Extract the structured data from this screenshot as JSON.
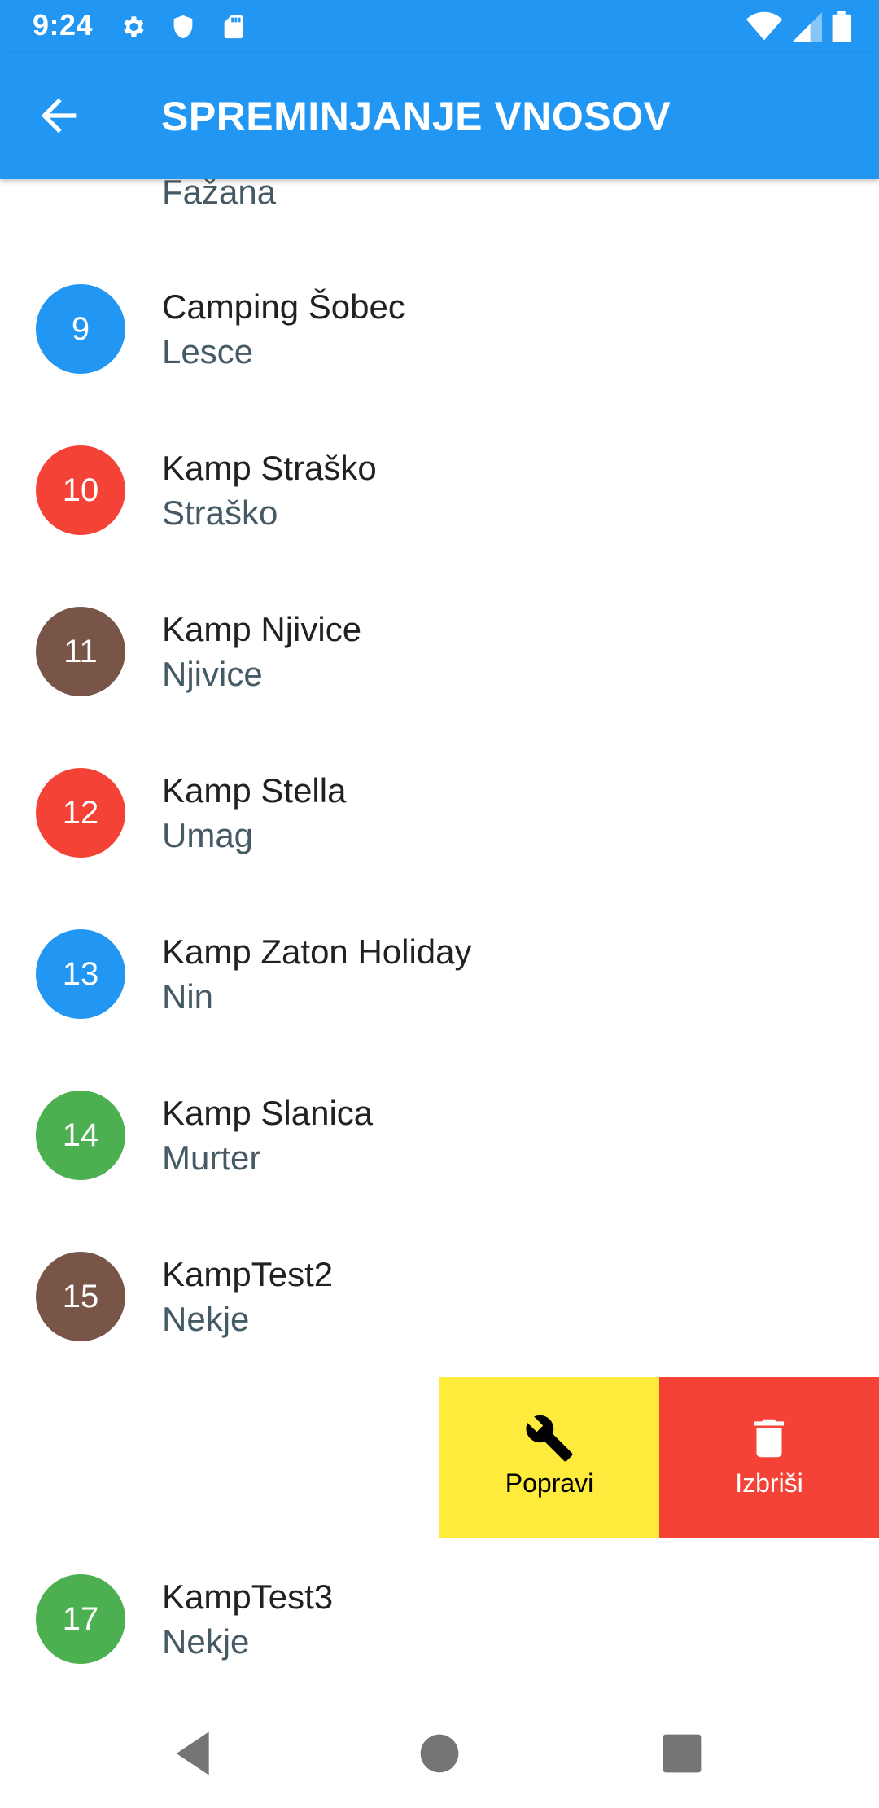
{
  "status_bar": {
    "time": "9:24",
    "left_icons": [
      "gear-icon",
      "shield-icon",
      "sd-card-icon"
    ],
    "right_icons": [
      "wifi-icon",
      "signal-icon",
      "battery-icon"
    ]
  },
  "app_bar": {
    "title": "SPREMINJANJE VNOSOV",
    "back_icon": "arrow-back-icon"
  },
  "colors": {
    "primary": "#2196F3",
    "green": "#4CAF50",
    "blue": "#2196F3",
    "red": "#F44336",
    "brown": "#795548",
    "edit_action": "#FFEB3B",
    "delete_action": "#F44336"
  },
  "list": {
    "partial_item": {
      "place": "Fažana"
    },
    "items": [
      {
        "number": "9",
        "name": "Camping Šobec",
        "place": "Lesce"
      },
      {
        "number": "10",
        "name": "Kamp Straško",
        "place": "Straško"
      },
      {
        "number": "11",
        "name": "Kamp Njivice",
        "place": "Njivice"
      },
      {
        "number": "12",
        "name": "Kamp Stella",
        "place": "Umag"
      },
      {
        "number": "13",
        "name": "Kamp Zaton Holiday",
        "place": "Nin"
      },
      {
        "number": "14",
        "name": "Kamp Slanica",
        "place": "Murter"
      },
      {
        "number": "15",
        "name": "KampTest2",
        "place": "Nekje"
      },
      {
        "number": "17",
        "name": "KampTest3",
        "place": "Nekje"
      }
    ]
  },
  "swipe_actions": {
    "edit_label": "Popravi",
    "edit_icon": "wrench-icon",
    "delete_label": "Izbriši",
    "delete_icon": "trash-icon"
  },
  "nav_bar": [
    "back-triangle-icon",
    "home-circle-icon",
    "recents-square-icon"
  ]
}
